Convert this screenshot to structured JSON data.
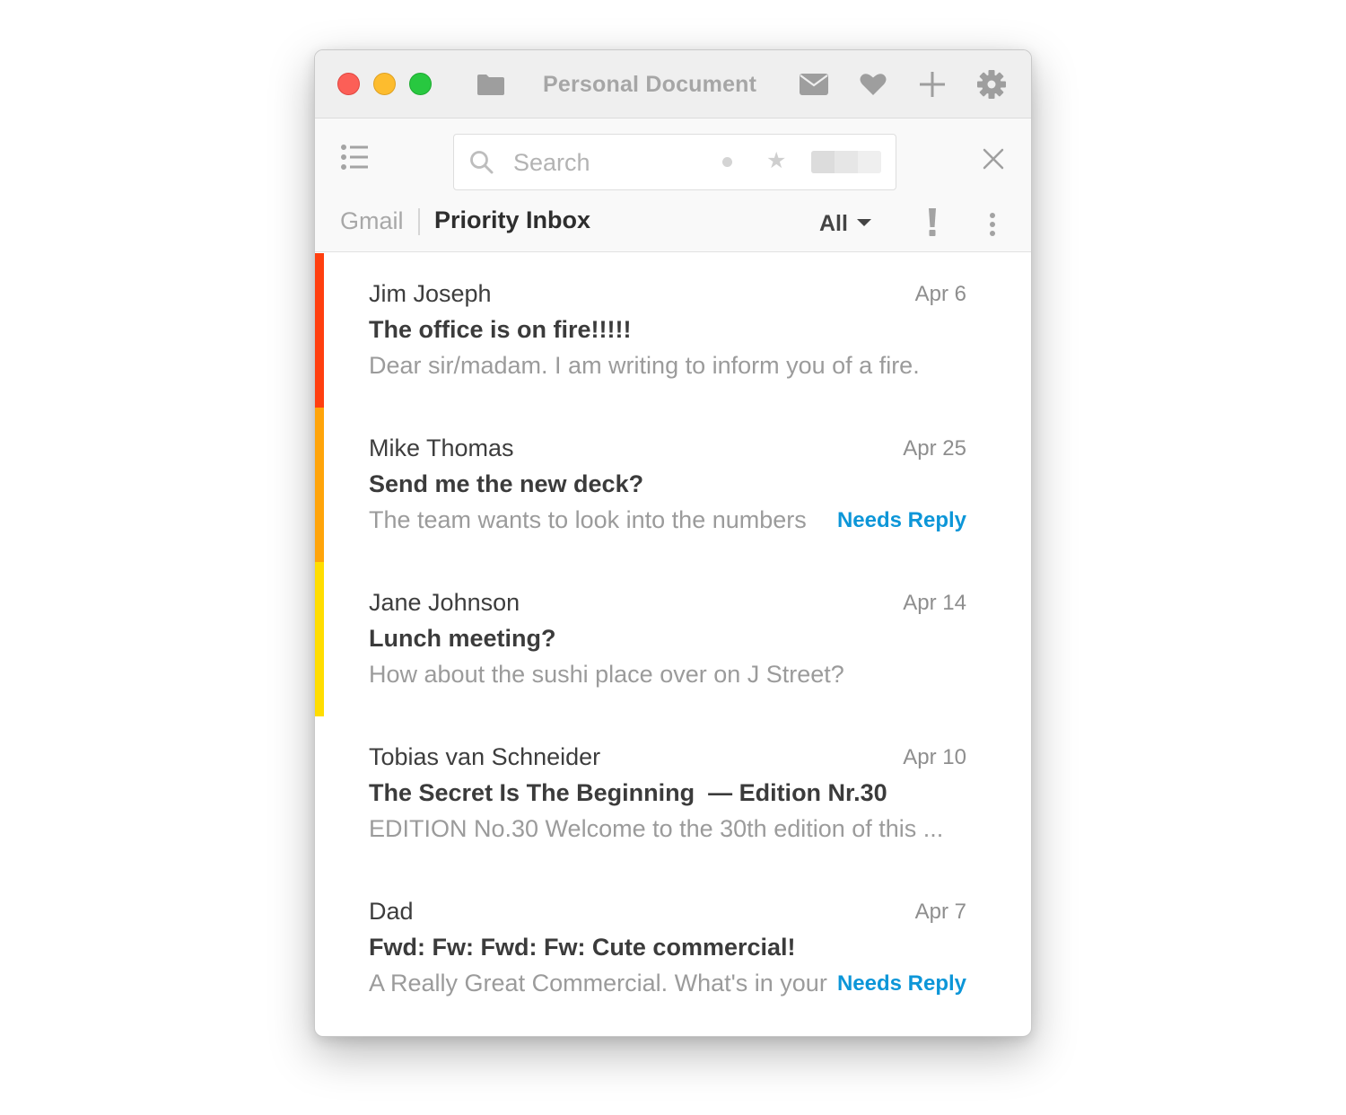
{
  "window": {
    "title": "Personal Document"
  },
  "titlebar_icons": [
    "folder-icon",
    "mail-icon",
    "heart-icon",
    "plus-icon",
    "gear-icon"
  ],
  "search": {
    "placeholder": "Search",
    "value": ""
  },
  "header": {
    "brand": "Gmail",
    "inbox_title": "Priority Inbox",
    "filter": "All"
  },
  "emails": [
    {
      "sender": "Jim Joseph",
      "date": "Apr 6",
      "subject": "The office is on fire!!!!!",
      "preview": "Dear sir/madam. I am writing to inform you of a fire.",
      "tag": "",
      "priority_color": "#ff3f0f"
    },
    {
      "sender": "Mike Thomas",
      "date": "Apr 25",
      "subject": "Send me the new deck?",
      "preview": "The team wants to look into the numbers",
      "tag": "Needs Reply",
      "priority_color": "#ffa40a"
    },
    {
      "sender": "Jane Johnson",
      "date": "Apr 14",
      "subject": "Lunch meeting?",
      "preview": "How about the sushi place over on J Street?",
      "tag": "",
      "priority_color": "#ffdd00"
    },
    {
      "sender": "Tobias van Schneider",
      "date": "Apr 10",
      "subject": "The Secret Is The Beginning  — Edition Nr.30",
      "preview": "EDITION No.30 Welcome to the 30th edition of this ...",
      "tag": "",
      "priority_color": ""
    },
    {
      "sender": "Dad",
      "date": "Apr 7",
      "subject": "Fwd: Fw: Fwd: Fw: Cute commercial!",
      "preview": "A Really Great Commercial. What's in your wallet?",
      "tag": "Needs Reply",
      "priority_color": ""
    }
  ],
  "colors": {
    "accent_blue": "#0c96d8",
    "traffic_red": "#fc5f57",
    "traffic_yellow": "#fdbc2e",
    "traffic_green": "#28c840"
  }
}
